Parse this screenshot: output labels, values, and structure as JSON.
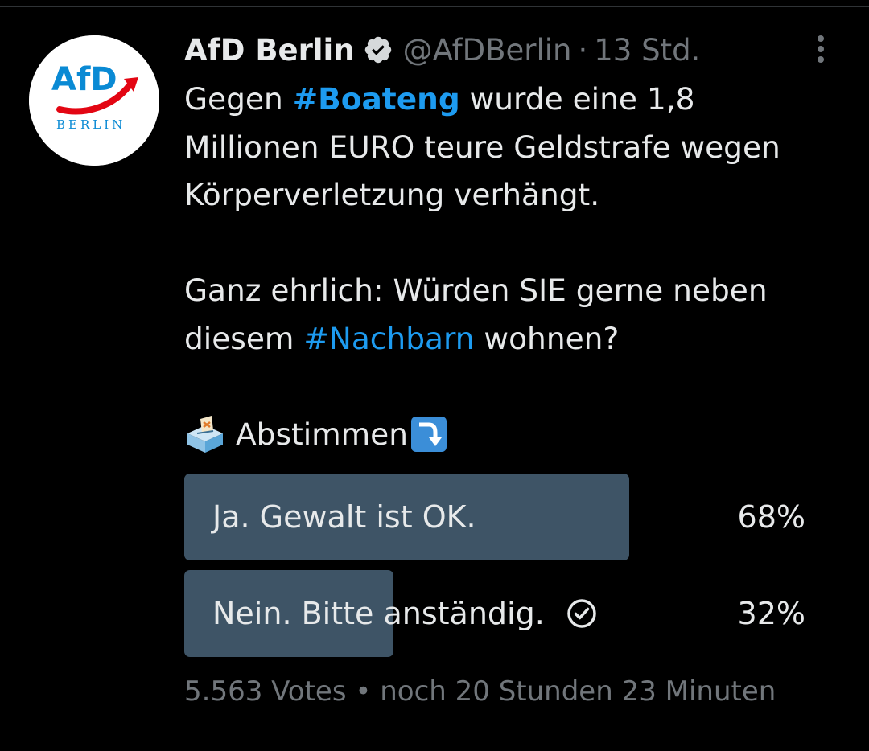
{
  "tweet": {
    "author_name": "AfD Berlin",
    "handle": "@AfDBerlin",
    "separator": "·",
    "time": "13 Std.",
    "avatar_text": "AfD",
    "avatar_subtext": "BERLIN",
    "text": {
      "line1_a": "Gegen ",
      "hashtag1": "#Boateng",
      "line1_b": " wurde eine 1,8",
      "line2": "Millionen EURO teure Geldstrafe wegen",
      "line3": "Körperverletzung verhängt.",
      "line4": "Ganz ehrlich: Würden SIE gerne neben",
      "line5_a": "diesem ",
      "hashtag2": "#Nachbarn",
      "line5_b": " wohnen?",
      "line6": "Abstimmen"
    }
  },
  "poll": {
    "options": [
      {
        "label": "Ja. Gewalt ist OK.",
        "percent_text": "68%",
        "percent": 68,
        "selected": false
      },
      {
        "label": "Nein. Bitte anständig.",
        "percent_text": "32%",
        "percent": 32,
        "selected": true
      }
    ],
    "votes": "5.563 Votes",
    "meta_separator": "•",
    "remaining": "noch 20 Stunden 23 Minuten"
  },
  "colors": {
    "background": "#000000",
    "text": "#e7e9ea",
    "secondary": "#71767b",
    "link": "#1d9bf0",
    "poll_bar": "#3e5466",
    "brand_blue": "#0a8ad4",
    "brand_red": "#e30613"
  },
  "icons": {
    "verified": "verified-badge-icon",
    "more": "more-options-icon",
    "ballot": "ballot-box-emoji",
    "arrow": "arrow-curving-down-emoji",
    "check": "check-circle-icon"
  }
}
